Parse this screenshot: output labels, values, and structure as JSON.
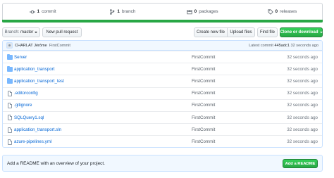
{
  "summary": {
    "commits": {
      "count": "1",
      "label": "commit"
    },
    "branches": {
      "count": "1",
      "label": "branch"
    },
    "packages": {
      "count": "0",
      "label": "packages"
    },
    "releases": {
      "count": "0",
      "label": "releases"
    },
    "language_bar_color": "#28a745"
  },
  "toolbar": {
    "branch_prefix": "Branch:",
    "branch_value": "master",
    "new_pr": "New pull request",
    "create_file": "Create new file",
    "upload_files": "Upload files",
    "find_file": "Find file",
    "clone": "Clone or download"
  },
  "commit": {
    "author": "CHARLAT Jérôme",
    "message": "FirstCommit",
    "latest_prefix": "Latest commit",
    "sha": "445adc1",
    "time": "32 seconds ago"
  },
  "files": [
    {
      "type": "folder-icon",
      "name": "Server",
      "message": "FirstCommit",
      "age": "32 seconds ago"
    },
    {
      "type": "folder-icon",
      "name": "application_transport",
      "message": "FirstCommit",
      "age": "32 seconds ago"
    },
    {
      "type": "folder-icon",
      "name": "application_transport_test",
      "message": "FirstCommit",
      "age": "32 seconds ago"
    },
    {
      "type": "file-icon",
      "name": ".editorconfig",
      "message": "FirstCommit",
      "age": "32 seconds ago"
    },
    {
      "type": "file-icon",
      "name": ".gitignore",
      "message": "FirstCommit",
      "age": "32 seconds ago"
    },
    {
      "type": "file-icon",
      "name": "SQLQuery1.sql",
      "message": "FirstCommit",
      "age": "32 seconds ago"
    },
    {
      "type": "file-icon",
      "name": "application_transport.sln",
      "message": "FirstCommit",
      "age": "32 seconds ago"
    },
    {
      "type": "file-icon",
      "name": "azure-pipelines.yml",
      "message": "FirstCommit",
      "age": "32 seconds ago"
    }
  ],
  "readme": {
    "text": "Add a README with an overview of your project.",
    "button": "Add a README"
  }
}
